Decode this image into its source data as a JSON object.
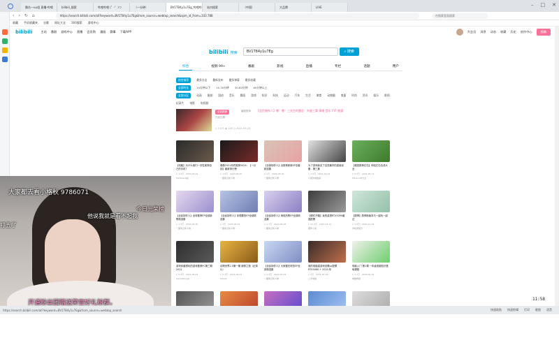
{
  "browser": {
    "tabs": [
      {
        "label": "舞台一uu组 直播-哔哩",
        "active": false
      },
      {
        "label": "bilibili_搜索",
        "active": false
      },
      {
        "label": "哔哩哔哩 (゜-゜)つ",
        "active": false
      },
      {
        "label": "（一分钟）",
        "active": false
      },
      {
        "label": "BV1TB4y1u7Eg_哔哩哔",
        "active": true
      },
      {
        "label": "站内搜索",
        "active": false
      },
      {
        "label": "（中国）",
        "active": false
      },
      {
        "label": "大品牌",
        "active": false
      },
      {
        "label": "LIVE",
        "active": false
      }
    ],
    "url": "https://search.bilibili.com/all?keyword=BV1T84y1u7Eg&from_source=webtop_search&spm_id_from=333.788",
    "search_placeholder": "在搜索里面搜索",
    "bookmarks": [
      "收藏",
      "手机收藏夹",
      "谷歌",
      "网址大全",
      "360搜索",
      "游戏中心",
      "下载APP"
    ]
  },
  "site": {
    "logo": "bilibili",
    "nav": [
      "主站",
      "番剧",
      "游戏中心",
      "直播",
      "会员购",
      "漫画",
      "赛事",
      "下载APP"
    ],
    "right_nav": [
      "大会员",
      "消息",
      "动态",
      "收藏",
      "历史",
      "创作中心"
    ],
    "upload_label": "投稿"
  },
  "search": {
    "logo_text": "bilibili",
    "logo_sub": "搜索",
    "query": "BV1T84y1u7Eg",
    "button": "搜索"
  },
  "tabs": [
    {
      "label": "综合",
      "active": true
    },
    {
      "label": "视频 99+",
      "active": false
    },
    {
      "label": "番剧",
      "active": false
    },
    {
      "label": "影视",
      "active": false
    },
    {
      "label": "直播",
      "active": false
    },
    {
      "label": "专栏",
      "active": false
    },
    {
      "label": "话题",
      "active": false
    },
    {
      "label": "用户",
      "active": false
    }
  ],
  "filters": {
    "row1": [
      "综合排序",
      "最多点击",
      "最新发布",
      "最多弹幕",
      "最多收藏"
    ],
    "row2": [
      "全部时长",
      "10分钟以下",
      "10-30分钟",
      "30-60分钟",
      "60分钟以上"
    ],
    "row3": [
      "全部分区",
      "动画",
      "番剧",
      "国创",
      "音乐",
      "舞蹈",
      "游戏",
      "知识",
      "科技",
      "运动",
      "汽车",
      "生活",
      "美食",
      "动物圈",
      "鬼畜",
      "时尚",
      "资讯",
      "娱乐",
      "影视",
      "纪录片",
      "电影",
      "电视剧"
    ]
  },
  "featured": {
    "badge": "全站推荐",
    "category": "番剧推荐",
    "title": "【全民制作人】哪！哪！三先生的雷总：外星三樂 演唱 音乐 FYF 摇滚",
    "desc": "已经过期",
    "meta": "▷ 1121  ◉ 126  ◷ 2021-05-24"
  },
  "videos": [
    {
      "title": "【电脑】为什么我们一次性卖掉自己的手机？",
      "meta": "▷ 1.0万 · 2020-04-24",
      "up": "Hardware咖"
    },
    {
      "title": "偶像2021年终推荐2024：【一分钟】最新排行榜",
      "meta": "▷ 1.6万 · 2020-06-05",
      "up": "一面笔记新人物"
    },
    {
      "title": "【全部制作人】全推荐新款EP全套精选集",
      "meta": "▷ 2万 · 2020-05-09",
      "up": "一面笔记新人物"
    },
    {
      "title": "为了游戏我买了这些最好的桌面设备 - 第三集",
      "meta": "▷ 1.5万 · 2021-02-04",
      "up": "小夏的电脑桌"
    },
    {
      "title": "【模型推荐红石】网站红石合成大全",
      "meta": "▷ 2.5万 · 2021-05-12",
      "up": "Minecraft大全"
    },
    {
      "title": "【全民制作人】全球推荐EP全部新歌精选集",
      "meta": "▷ 1.3万 · 2020-05-30",
      "up": "一面笔记新人物"
    },
    {
      "title": "【全民制作人】你想要的EP全部精选集",
      "meta": "▷ 3万 · 2020-06-01",
      "up": "一面笔记新人物"
    },
    {
      "title": "【全民制作人】网络热歌EP全部精选集",
      "meta": "▷ 1.7万 · 2020-06-08",
      "up": "一面笔记新人物"
    },
    {
      "title": "【硬件开箱】我的桌搭RTX3090最强配置",
      "meta": "▷ 21.4万 · 2021-03-12",
      "up": "硬件小哥"
    },
    {
      "title": "【原神】原神新版本与一起玩一起过",
      "meta": "▷ 1.8万 · 2020-12-18",
      "up": "米哈游官方"
    },
    {
      "title": "游戏你最想玩的游戏推荐PC第三期 2021",
      "meta": "▷ 5.4万 · 2021-06-04",
      "up": "GameRanger"
    },
    {
      "title": "动物世界2.0第一期 新鲜之旅（纪录片）",
      "meta": "▷ 2.1万 · 2021-02-22",
      "up": "PlayAll"
    },
    {
      "title": "【全民制作人】大家都在听的EP全部精选集",
      "meta": "▷ 1.3万 · 2020-05-09",
      "up": "一面笔记新人物"
    },
    {
      "title": "我的电脑桌游戏设置pc配置 RTX3080 + 2020 年",
      "meta": "▷ 2万 · 2021-01-26",
      "up": "二手电脑"
    },
    {
      "title": "电脑入门 第1课 一年级电脑知识基础课程",
      "meta": "▷ 1.1万 · 2020-09-16",
      "up": "电脑教程"
    },
    {
      "title": "",
      "meta": "",
      "up": ""
    },
    {
      "title": "",
      "meta": "",
      "up": ""
    },
    {
      "title": "",
      "meta": "",
      "up": ""
    },
    {
      "title": "",
      "meta": "",
      "up": ""
    },
    {
      "title": "",
      "meta": "",
      "up": ""
    }
  ],
  "webcam": {
    "danmaku": [
      "大家都去看小格秋  9786071",
      "今日光荣榜",
      "他说我就是看不起我",
      "打五了",
      "开通粉丝团赠送荣誉好礼粉群。"
    ]
  },
  "taskbar": {
    "url_preview": "https://search.bilibili.com/all?keyword=BV1T84y1u7Eg&from_source=webtop_search",
    "right_items": [
      "快速粘贴",
      "快速剪辑",
      "打印",
      "截图",
      "语音"
    ],
    "clock": "11:58"
  },
  "colors": {
    "accent": "#00a1d6",
    "pink": "#fb7299"
  }
}
